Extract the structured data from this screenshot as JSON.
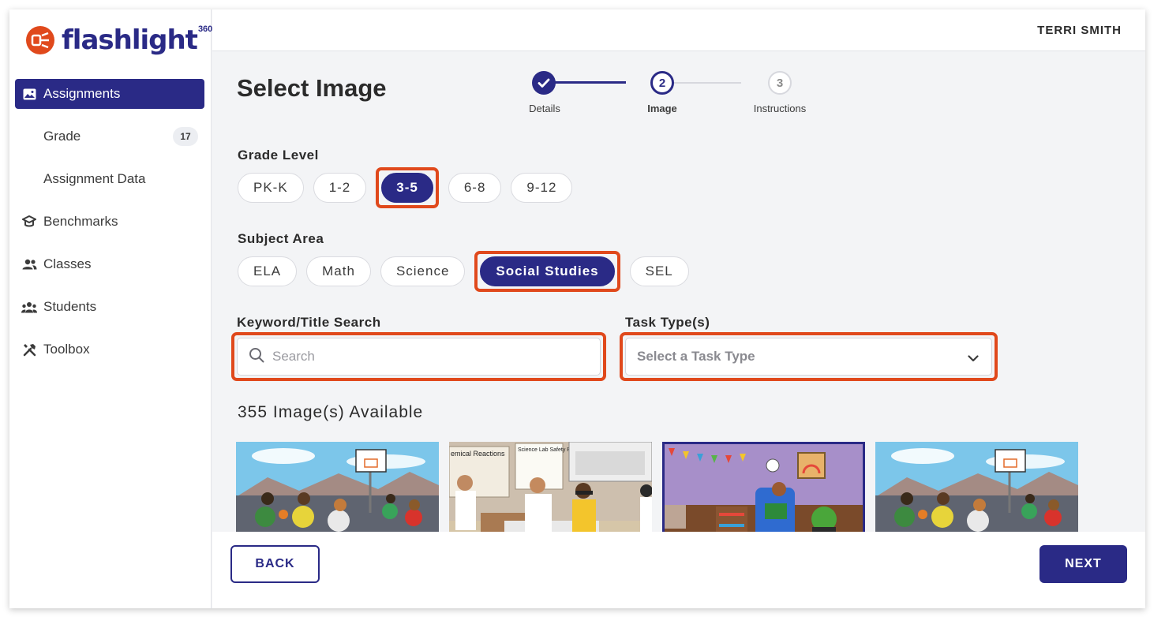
{
  "app": {
    "logo_text": "flashlight",
    "logo_superscript": "360",
    "brand_color": "#2a2a86",
    "accent_color": "#e0491c"
  },
  "header": {
    "user_name": "TERRI SMITH"
  },
  "sidebar": {
    "items": [
      {
        "label": "Assignments",
        "icon": "image-icon",
        "active": true
      },
      {
        "label": "Grade",
        "badge": "17",
        "sub": true
      },
      {
        "label": "Assignment Data",
        "sub": true
      },
      {
        "label": "Benchmarks",
        "icon": "graduation-cap-icon"
      },
      {
        "label": "Classes",
        "icon": "users-icon"
      },
      {
        "label": "Students",
        "icon": "group-icon"
      },
      {
        "label": "Toolbox",
        "icon": "tools-icon"
      }
    ]
  },
  "page": {
    "title": "Select Image"
  },
  "stepper": {
    "steps": [
      {
        "number": "1",
        "label": "Details",
        "state": "done"
      },
      {
        "number": "2",
        "label": "Image",
        "state": "current"
      },
      {
        "number": "3",
        "label": "Instructions",
        "state": "todo"
      }
    ]
  },
  "grade_level": {
    "label": "Grade Level",
    "options": [
      "PK-K",
      "1-2",
      "3-5",
      "6-8",
      "9-12"
    ],
    "selected": "3-5"
  },
  "subject_area": {
    "label": "Subject Area",
    "options": [
      "ELA",
      "Math",
      "Science",
      "Social Studies",
      "SEL"
    ],
    "selected": "Social Studies"
  },
  "search": {
    "label": "Keyword/Title Search",
    "placeholder": "Search",
    "value": ""
  },
  "task_type": {
    "label": "Task Type(s)",
    "placeholder": "Select a Task Type"
  },
  "results": {
    "count_text": "355 Image(s) Available",
    "thumbnails": [
      {
        "name": "basketball-court-image",
        "selected": false
      },
      {
        "name": "science-lab-image",
        "selected": false,
        "poster_text_1": "emical Reactions",
        "poster_text_2": "Science Lab Safety Rules"
      },
      {
        "name": "reading-room-image",
        "selected": true
      },
      {
        "name": "basketball-court-image-2",
        "selected": false
      }
    ]
  },
  "footer": {
    "back_label": "BACK",
    "next_label": "NEXT"
  }
}
